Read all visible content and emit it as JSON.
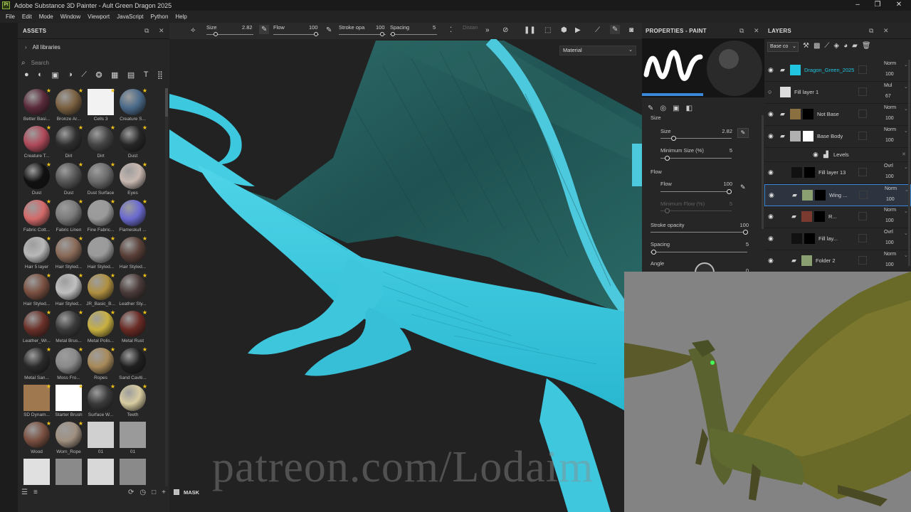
{
  "window": {
    "title": "Adobe Substance 3D Painter - Ault Green Dragon 2025",
    "logo": "Pt"
  },
  "menu": [
    "File",
    "Edit",
    "Mode",
    "Window",
    "Viewport",
    "JavaScript",
    "Python",
    "Help"
  ],
  "assets": {
    "title": "ASSETS",
    "library": "All libraries",
    "search_placeholder": "Search",
    "filter_icons": [
      "sphere-icon",
      "half-sphere-icon",
      "square-icon",
      "gradient-icon",
      "brush-icon",
      "particle-icon",
      "grid-icon",
      "environment-icon",
      "text-icon",
      "tiles-icon"
    ],
    "items": [
      {
        "label": "Better Basi...",
        "color": "#5a2a3a",
        "star": true
      },
      {
        "label": "Bronze Ar...",
        "color": "#7a6040",
        "star": true
      },
      {
        "label": "Cells 3",
        "color": "#f2f2f2",
        "square": true,
        "star": true
      },
      {
        "label": "Creature S...",
        "color": "#4a6a8a",
        "star": true
      },
      {
        "label": "Creature T...",
        "color": "#b04a5a",
        "star": true
      },
      {
        "label": "Dirt",
        "color": "#2f2f2f",
        "star": true
      },
      {
        "label": "Dirt",
        "color": "#444444",
        "star": true
      },
      {
        "label": "Dust",
        "color": "#262626",
        "star": true
      },
      {
        "label": "Dust",
        "color": "#111111",
        "star": true
      },
      {
        "label": "Dust",
        "color": "#555555",
        "star": true
      },
      {
        "label": "Dust Surface",
        "color": "#6a6a6a",
        "star": true
      },
      {
        "label": "Eyes",
        "color": "#c8b8b0",
        "star": true
      },
      {
        "label": "Fabric Cott...",
        "color": "#d46a6a",
        "star": true
      },
      {
        "label": "Fabric Linen",
        "color": "#7a7a7a",
        "star": true
      },
      {
        "label": "Fine Fabric...",
        "color": "#9a9a9a",
        "star": true
      },
      {
        "label": "Flameskull ...",
        "color": "#6a6ad0",
        "star": true
      },
      {
        "label": "Hair 5 layer",
        "color": "#b8b8b8",
        "star": true
      },
      {
        "label": "Hair Styled...",
        "color": "#8a6a58",
        "star": true
      },
      {
        "label": "Hair Styled...",
        "color": "#9a9a9a",
        "star": true
      },
      {
        "label": "Hair Styled...",
        "color": "#5a4038",
        "star": true
      },
      {
        "label": "Hair Styled...",
        "color": "#7a5040",
        "star": true
      },
      {
        "label": "Hair Styled...",
        "color": "#c0c0c0",
        "star": true
      },
      {
        "label": "JR_Basic_B...",
        "color": "#b09040",
        "star": true
      },
      {
        "label": "Leather Sty...",
        "color": "#4a3a38",
        "star": true
      },
      {
        "label": "Leather_Wr...",
        "color": "#6a3028",
        "star": true
      },
      {
        "label": "Metal Brus...",
        "color": "#3a3a3a",
        "star": true
      },
      {
        "label": "Metal Polis...",
        "color": "#c8b040",
        "star": true
      },
      {
        "label": "Metal Rust",
        "color": "#6a2a24",
        "star": true
      },
      {
        "label": "Metal San...",
        "color": "#2a2a2a",
        "star": true
      },
      {
        "label": "Moss Fro...",
        "color": "#8a8a8a",
        "star": true
      },
      {
        "label": "Ropes",
        "color": "#a88a5a",
        "star": true
      },
      {
        "label": "Sand Caviti...",
        "color": "#202020",
        "star": true
      },
      {
        "label": "SD Dynam...",
        "color": "#a07850",
        "square": true,
        "star": true
      },
      {
        "label": "Starter Brush",
        "color": "#ffffff",
        "square": true,
        "star": true
      },
      {
        "label": "Surface W...",
        "color": "#3a3a3a",
        "star": true
      },
      {
        "label": "Teeth",
        "color": "#d8cca0",
        "star": true
      },
      {
        "label": "Wood",
        "color": "#7a5040",
        "star": true
      },
      {
        "label": "Worn_Rope",
        "color": "#a09080",
        "star": true
      },
      {
        "label": "01",
        "color": "#d0d0d0",
        "square": true,
        "star": false
      },
      {
        "label": "01",
        "color": "#9a9a9a",
        "square": true,
        "star": false
      },
      {
        "label": "",
        "color": "#e0e0e0",
        "square": true,
        "star": false
      },
      {
        "label": "",
        "color": "#8a8a8a",
        "square": true,
        "star": false
      },
      {
        "label": "",
        "color": "#d8d8d8",
        "square": true,
        "star": false
      },
      {
        "label": "",
        "color": "#8a8a8a",
        "square": true,
        "star": false
      }
    ]
  },
  "toolbar": {
    "size_label": "Size",
    "size_value": "2.82",
    "flow_label": "Flow",
    "flow_value": "100",
    "stroke_label": "Stroke opa",
    "stroke_value": "100",
    "spacing_label": "Spacing",
    "spacing_value": "5",
    "distance_label": "Distan"
  },
  "viewport": {
    "material_select": "Material",
    "mask_label": "MASK",
    "watermark": "patreon.com/Lodaim"
  },
  "properties": {
    "title": "PROPERTIES - PAINT",
    "size_section": "Size",
    "size_label": "Size",
    "size_value": "2.82",
    "min_size_label": "Minimum Size (%)",
    "min_size_value": "5",
    "flow_section": "Flow",
    "flow_label": "Flow",
    "flow_value": "100",
    "min_flow_label": "Minimum Flow (%)",
    "min_flow_value": "5",
    "stroke_label": "Stroke opacity",
    "stroke_value": "100",
    "spacing_label": "Spacing",
    "spacing_value": "5",
    "angle_label": "Angle",
    "angle_value": "0"
  },
  "layers": {
    "title": "LAYERS",
    "blend_select": "Base co",
    "items": [
      {
        "name": "Dragon_Green_2025",
        "blend": "Norm",
        "opacity": "100",
        "visible": true,
        "highlight": true,
        "thumb": "#22c5e0",
        "folder": true
      },
      {
        "name": "Fill layer 1",
        "blend": "Mul",
        "opacity": "67",
        "visible": false,
        "thumb": "#dcdcdc"
      },
      {
        "name": "Not Base",
        "blend": "Norm",
        "opacity": "100",
        "visible": true,
        "thumb": "#8a7040",
        "mask": "#000000",
        "folder": true
      },
      {
        "name": "Base Body",
        "blend": "Norm",
        "opacity": "100",
        "visible": true,
        "thumb": "#b0b0b0",
        "mask": "#ffffff",
        "folder": true
      },
      {
        "name": "Levels",
        "sub": true
      },
      {
        "name": "Fill layer 13",
        "blend": "Ovrl",
        "opacity": "100",
        "visible": true,
        "thumb": "#111111",
        "mask": "#000000"
      },
      {
        "name": "Wing ...",
        "blend": "Norm",
        "opacity": "100",
        "visible": true,
        "selected": true,
        "thumb": "#8aa070",
        "mask": "#000000",
        "folder": true
      },
      {
        "name": "R...",
        "blend": "Norm",
        "opacity": "100",
        "visible": true,
        "thumb": "#7a3a30",
        "mask": "#000000",
        "folder": true
      },
      {
        "name": "Fill lay...",
        "blend": "Ovrl",
        "opacity": "100",
        "visible": true,
        "thumb": "#111111",
        "mask": "#000000"
      },
      {
        "name": "Folder 2",
        "blend": "Norm",
        "opacity": "100",
        "visible": true,
        "thumb": "#8aa070",
        "folder": true
      }
    ]
  }
}
